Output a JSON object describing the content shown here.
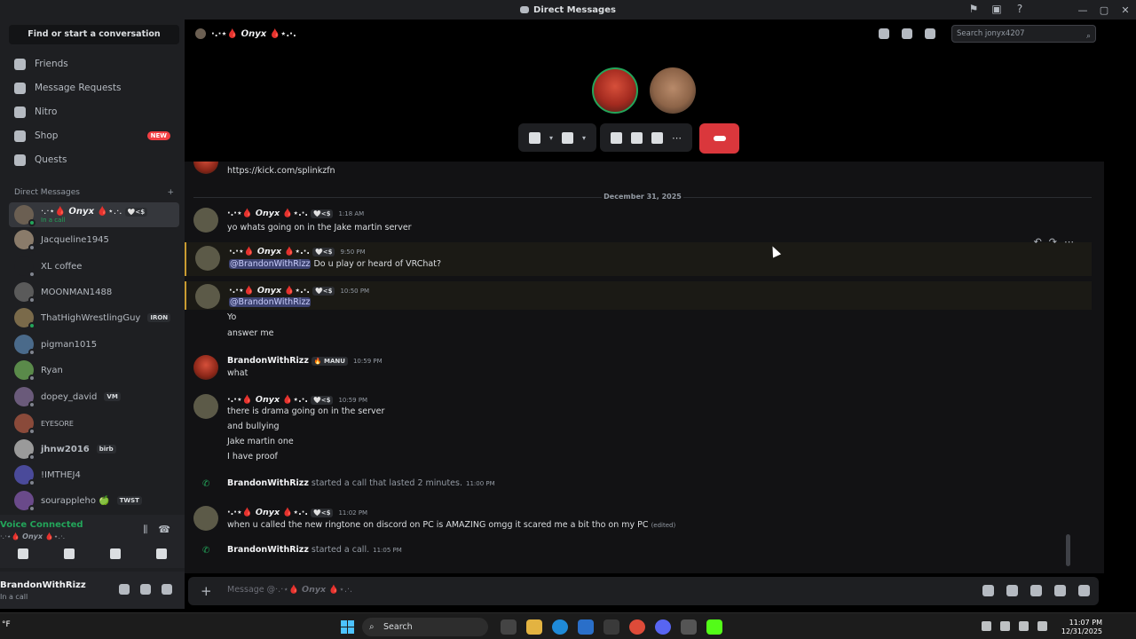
{
  "window": {
    "title": "Direct Messages"
  },
  "sidebar": {
    "find_label": "Find or start a conversation",
    "nav": [
      {
        "label": "Friends",
        "icon": "friends-icon"
      },
      {
        "label": "Message Requests",
        "icon": "mail-icon"
      },
      {
        "label": "Nitro",
        "icon": "nitro-icon"
      },
      {
        "label": "Shop",
        "icon": "shop-icon",
        "badge": "NEW"
      },
      {
        "label": "Quests",
        "icon": "quests-icon"
      }
    ],
    "dm_header": "Direct Messages",
    "dm_add": "+",
    "dms": [
      {
        "name": "·.·⋆🩸 𝙊𝙣𝙮𝙭 🩸⋆.·.",
        "tag": "🤍<$",
        "sub": "In a call",
        "status": "online"
      },
      {
        "name": "Jacqueline1945",
        "status": "off"
      },
      {
        "name": "XL coffee",
        "status": "off"
      },
      {
        "name": "MOONMAN1488",
        "status": "off"
      },
      {
        "name": "ThatHighWrestlingGuy",
        "tag": "IRON",
        "status": "online"
      },
      {
        "name": "pigman1015",
        "status": "off"
      },
      {
        "name": "Ryan",
        "status": "off"
      },
      {
        "name": "dopey_david",
        "tag": "VM",
        "status": "off"
      },
      {
        "name": "EYESORE",
        "status": "off"
      },
      {
        "name": "jhnw2016",
        "tag": "birb",
        "status": "off"
      },
      {
        "name": "!IMTHEJ4",
        "status": "off"
      },
      {
        "name": "sourappleho 🍏",
        "tag": "TWST",
        "status": "off"
      }
    ],
    "voice": {
      "title": "Voice Connected",
      "sub": "·.·⋆🩸 𝙊𝙣𝙮𝙭 🩸⋆.·."
    },
    "user": {
      "name": "BrandonWithRizz",
      "status": "In a call"
    }
  },
  "header": {
    "title": "·.·⋆🩸 𝙊𝙣𝙮𝙭 🩸⋆.·.",
    "search_placeholder": "Search jonyx4207"
  },
  "messages": {
    "link": "https://kick.com/splinkzfn",
    "date": "December 31, 2025",
    "onyx_name": "·.·⋆🩸 𝙊𝙣𝙮𝙭 🩸⋆.·.",
    "onyx_tag": "🤍<$",
    "brandon_name": "BrandonWithRizz",
    "brandon_tag": "🔥 MANU",
    "m1": {
      "time": "1:18 AM",
      "text": "yo whats going on in the Jake martin server"
    },
    "m2": {
      "time": "9:50 PM",
      "mention": "@BrandonWithRizz",
      "text": " Do u play or heard of VRChat?"
    },
    "m3": {
      "time": "10:50 PM",
      "mention": "@BrandonWithRizz",
      "l2": "Yo",
      "l3": "answer me"
    },
    "m4": {
      "time": "10:59 PM",
      "text": "what"
    },
    "m5": {
      "time": "10:59 PM",
      "l1": "there is drama going on in the server",
      "l2": "and bullying",
      "l3": "Jake martin one",
      "l4": "I have proof"
    },
    "s1": {
      "text": " started a call that lasted 2 minutes.",
      "time": "11:00 PM"
    },
    "m6": {
      "time": "11:02 PM",
      "text": "when u called the new ringtone on discord on PC is AMAZING omgg it scared me a bit tho on my PC",
      "edited": "(edited)"
    },
    "s2": {
      "text": " started a call.",
      "time": "11:05 PM"
    }
  },
  "composer": {
    "placeholder": "Message @·.·⋆🩸 𝙊𝙣𝙮𝙭 🩸⋆.·."
  },
  "taskbar": {
    "left": "°F",
    "search": "Search",
    "time": "11:07 PM",
    "date": "12/31/2025"
  },
  "colors": {
    "accent": "#5865f2",
    "online": "#23a55a",
    "danger": "#da373c",
    "link": "#00a8fc"
  }
}
